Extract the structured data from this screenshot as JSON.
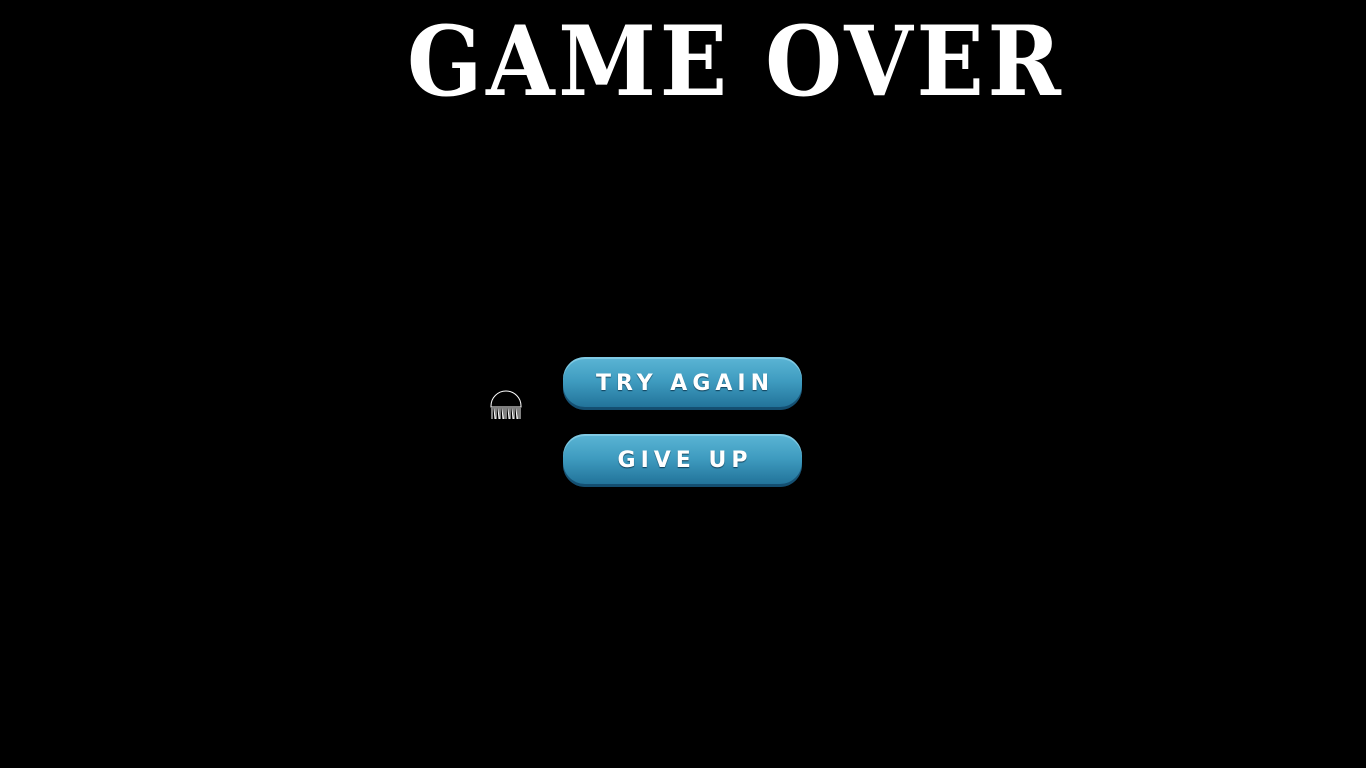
{
  "title": "GAME OVER",
  "menu": {
    "try_again_label": "TRY AGAIN",
    "give_up_label": "GIVE UP"
  },
  "colors": {
    "background": "#000000",
    "title": "#ffffff",
    "button_top": "#5bb5d5",
    "button_bottom": "#1f6f96",
    "button_text": "#ffffff"
  },
  "cursor_icon": "jellyfish-cursor-icon"
}
